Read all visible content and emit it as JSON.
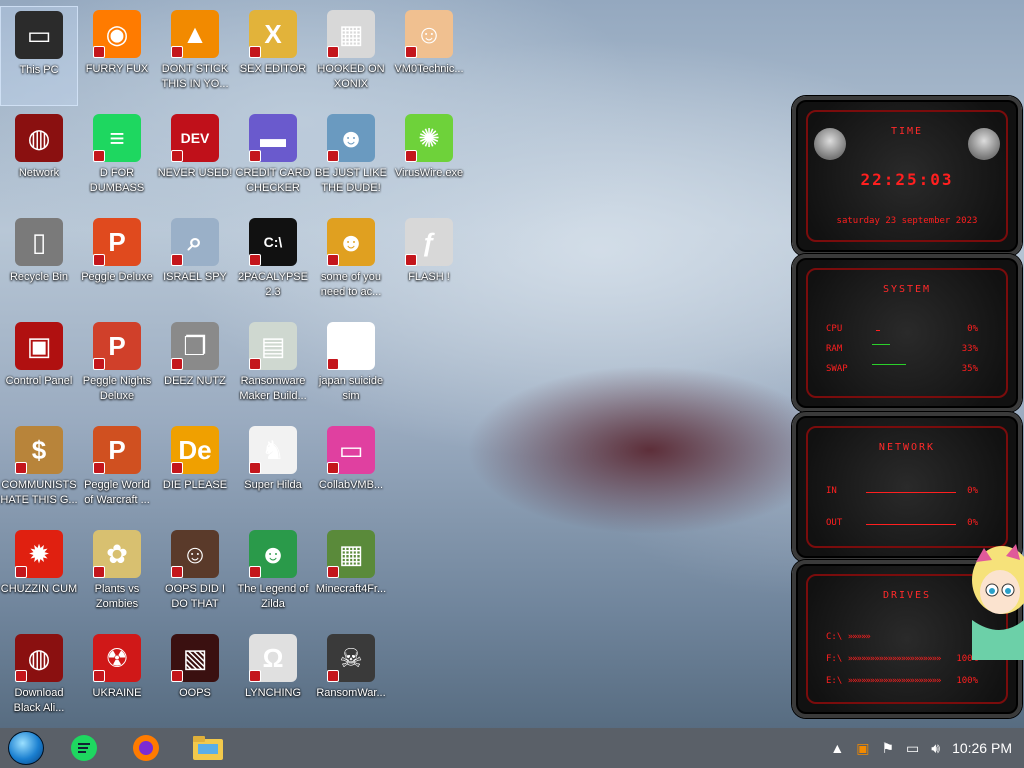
{
  "desktop": {
    "icons": [
      {
        "label": "This PC",
        "icon": "computer-icon",
        "color": "#2b2b2b",
        "glyph": "▭"
      },
      {
        "label": "FURRY FUX",
        "icon": "firefox-icon",
        "color": "#ff7b00",
        "glyph": "◉"
      },
      {
        "label": "DONT STICK THIS IN YO...",
        "icon": "vlc-cone-icon",
        "color": "#f28a00",
        "glyph": "▲"
      },
      {
        "label": "SEX EDITOR",
        "icon": "hxd-icon",
        "color": "#e2b33a",
        "glyph": "X"
      },
      {
        "label": "HOOKED ON XONIX",
        "icon": "xonix-icon",
        "color": "#d8d8d8",
        "glyph": "▦"
      },
      {
        "label": "VM0Technic...",
        "icon": "doctor-icon",
        "color": "#f0c090",
        "glyph": "☺"
      },
      {
        "label": "Network",
        "icon": "network-icon",
        "color": "#8a1010",
        "glyph": "◍"
      },
      {
        "label": "D FOR DUMBASS",
        "icon": "message-icon",
        "color": "#1ed760",
        "glyph": "≡"
      },
      {
        "label": "NEVER USED!",
        "icon": "devcpp-icon",
        "color": "#c0101a",
        "glyph": "DEV"
      },
      {
        "label": "CREDIT CARD CHECKER",
        "icon": "credit-card-icon",
        "color": "#6a5acd",
        "glyph": "▬"
      },
      {
        "label": "BE JUST LIKE THE DUDE!",
        "icon": "dude-icon",
        "color": "#6a9ac0",
        "glyph": "☻"
      },
      {
        "label": "VirusWire.exe",
        "icon": "lime-icon",
        "color": "#6ed23a",
        "glyph": "✺"
      },
      {
        "label": "Recycle Bin",
        "icon": "recycle-bin-icon",
        "color": "#7a7a7a",
        "glyph": "▯"
      },
      {
        "label": "Peggle Deluxe",
        "icon": "peggle-icon",
        "color": "#e04a1e",
        "glyph": "P"
      },
      {
        "label": "ISRAEL SPY",
        "icon": "spy-icon",
        "color": "#9ab0c8",
        "glyph": "⌕"
      },
      {
        "label": "2PACALYPSE 2.3",
        "icon": "terminal-icon",
        "color": "#111111",
        "glyph": "C:\\"
      },
      {
        "label": "some of you need to ac...",
        "icon": "dog-icon",
        "color": "#e0a020",
        "glyph": "☻"
      },
      {
        "label": "FLASH !",
        "icon": "flash-icon",
        "color": "#d8d8d8",
        "glyph": "ƒ"
      },
      {
        "label": "Control Panel",
        "icon": "control-panel-icon",
        "color": "#b01010",
        "glyph": "▣"
      },
      {
        "label": "Peggle Nights Deluxe",
        "icon": "peggle-nights-icon",
        "color": "#d0402a",
        "glyph": "P"
      },
      {
        "label": "DEEZ NUTZ",
        "icon": "stack-windows-icon",
        "color": "#8a8a8a",
        "glyph": "❐"
      },
      {
        "label": "Ransomware Maker Build...",
        "icon": "window-app-icon",
        "color": "#cfd8d0",
        "glyph": "▤"
      },
      {
        "label": "japan suicide sim",
        "icon": "japan-sim-icon",
        "color": "#ffffff",
        "glyph": "⁂"
      },
      {
        "label": "",
        "icon": "",
        "color": "",
        "glyph": ""
      },
      {
        "label": "COMMUNISTS HATE THIS G...",
        "icon": "money-bag-icon",
        "color": "#b8843a",
        "glyph": "$"
      },
      {
        "label": "Peggle World of Warcraft ...",
        "icon": "peggle-wow-icon",
        "color": "#d05020",
        "glyph": "P"
      },
      {
        "label": "DIE PLEASE",
        "icon": "de-icon",
        "color": "#f0a000",
        "glyph": "De"
      },
      {
        "label": "Super Hilda",
        "icon": "hilda-icon",
        "color": "#f2f2f2",
        "glyph": "♞"
      },
      {
        "label": "CollabVMB...",
        "icon": "monitor-icon",
        "color": "#e040a0",
        "glyph": "▭"
      },
      {
        "label": "",
        "icon": "",
        "color": "",
        "glyph": ""
      },
      {
        "label": "CHUZZIN CUM",
        "icon": "chuzzle-icon",
        "color": "#e02010",
        "glyph": "✹"
      },
      {
        "label": "Plants vs Zombies",
        "icon": "flower-icon",
        "color": "#d8c070",
        "glyph": "✿"
      },
      {
        "label": "OOPS DID I DO THAT",
        "icon": "portrait-icon",
        "color": "#5a3a2a",
        "glyph": "☺"
      },
      {
        "label": "The Legend of Zilda",
        "icon": "zelda-icon",
        "color": "#2a9a4a",
        "glyph": "☻"
      },
      {
        "label": "Minecraft4Fr...",
        "icon": "minecraft-icon",
        "color": "#5a8a3a",
        "glyph": "▦"
      },
      {
        "label": "",
        "icon": "",
        "color": "",
        "glyph": ""
      },
      {
        "label": "Download Black Ali...",
        "icon": "alien-orb-icon",
        "color": "#8a1010",
        "glyph": "◍"
      },
      {
        "label": "UKRAINE",
        "icon": "radiation-icon",
        "color": "#d01818",
        "glyph": "☢"
      },
      {
        "label": "OOPS",
        "icon": "oops-icon",
        "color": "#3a1010",
        "glyph": "▧"
      },
      {
        "label": "LYNCHING",
        "icon": "noose-icon",
        "color": "#e0e0e0",
        "glyph": "Ω"
      },
      {
        "label": "RansomWar...",
        "icon": "skull-icon",
        "color": "#3a3a3a",
        "glyph": "☠"
      }
    ]
  },
  "widget": {
    "time": {
      "title": "TIME",
      "clock": "22:25:03",
      "date": "saturday 23 september 2023"
    },
    "system": {
      "title": "SYSTEM",
      "rows": [
        {
          "label": "CPU",
          "value": "0%",
          "level": 0.04
        },
        {
          "label": "RAM",
          "value": "33%",
          "level": 0.33
        },
        {
          "label": "SWAP",
          "value": "35%",
          "level": 0.35
        }
      ]
    },
    "network": {
      "title": "NETWORK",
      "rows": [
        {
          "label": "IN",
          "value": "0%"
        },
        {
          "label": "OUT",
          "value": "0%"
        }
      ]
    },
    "drives": {
      "title": "DRIVES",
      "rows": [
        {
          "label": "C:\\",
          "value": "",
          "arrows": "»»»»»"
        },
        {
          "label": "F:\\",
          "value": "100%",
          "arrows": "»»»»»»»»»»»»»»»»»»»»»"
        },
        {
          "label": "E:\\",
          "value": "100%",
          "arrows": "»»»»»»»»»»»»»»»»»»»»»"
        }
      ]
    }
  },
  "taskbar": {
    "apps": [
      {
        "name": "message-app-icon",
        "color": "#1ed760"
      },
      {
        "name": "firefox-taskbar-icon",
        "color": "#ff7b00"
      },
      {
        "name": "file-explorer-icon",
        "color": "#f2c94c"
      }
    ],
    "clock": "10:26 PM"
  }
}
